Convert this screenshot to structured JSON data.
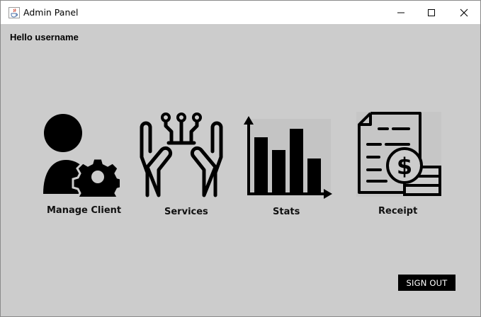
{
  "window": {
    "title": "Admin Panel",
    "icon": "java-cup-icon",
    "controls": [
      "minimize-icon",
      "maximize-icon",
      "close-icon"
    ]
  },
  "greeting": {
    "text": "Hello  username"
  },
  "tiles": [
    {
      "label": "Manage Client",
      "icon": "user-gear-icon"
    },
    {
      "label": "Services",
      "icon": "hands-circuit-icon"
    },
    {
      "label": "Stats",
      "icon": "bar-chart-icon"
    },
    {
      "label": "Receipt",
      "icon": "receipt-coins-icon"
    }
  ],
  "signout": {
    "label": "SIGN OUT"
  }
}
